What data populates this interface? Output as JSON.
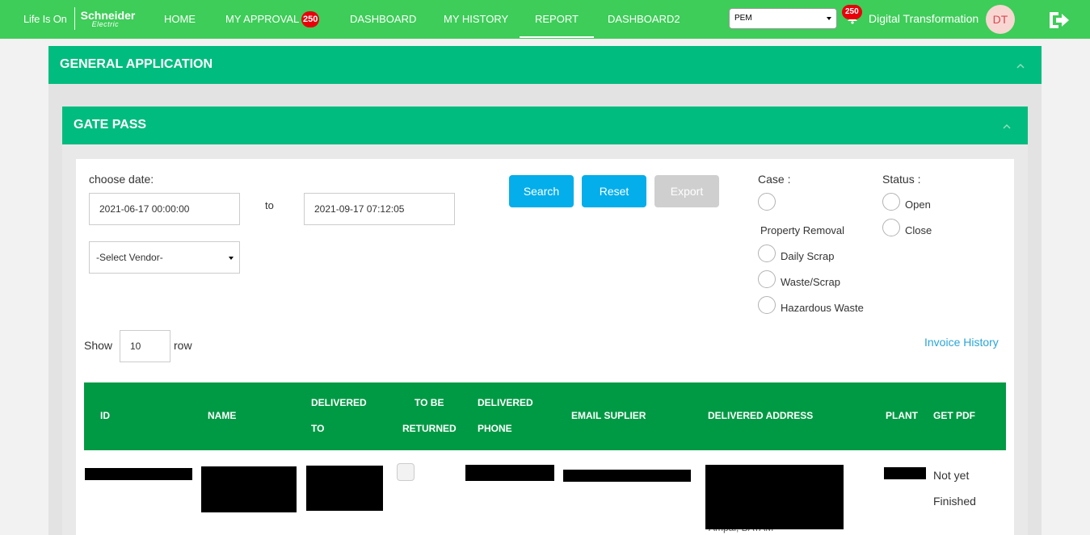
{
  "header": {
    "brand_lifeison": "Life Is On",
    "brand_name": "Schneider",
    "brand_sub": "Electric",
    "nav": [
      {
        "label": "HOME"
      },
      {
        "label": "MY APPROVAL",
        "badge": "250"
      },
      {
        "label": "DASHBOARD"
      },
      {
        "label": "MY HISTORY"
      },
      {
        "label": "REPORT",
        "active": true
      },
      {
        "label": "DASHBOARD2"
      }
    ],
    "plant_select": "PEM",
    "notification_count": "250",
    "user_name": "Digital Transformation",
    "avatar_initials": "DT"
  },
  "panels": {
    "general_title": "GENERAL APPLICATION",
    "gate_title": "GATE PASS"
  },
  "filters": {
    "choose_date_label": "choose date:",
    "date_from": "2021-06-17 00:00:00",
    "to_label": "to",
    "date_to": "2021-09-17 07:12:05",
    "vendor_select": "-Select Vendor-",
    "search_label": "Search",
    "reset_label": "Reset",
    "export_label": "Export",
    "case_label": "Case :",
    "case_options": [
      "Property Removal",
      "Daily Scrap",
      "Waste/Scrap",
      "Hazardous Waste"
    ],
    "status_label": "Status :",
    "status_options": [
      "Open",
      "Close"
    ],
    "show_label": "Show",
    "rows_value": "10",
    "row_label": "row",
    "invoice_history": "Invoice History"
  },
  "table": {
    "headers": {
      "id": "ID",
      "name": "NAME",
      "delivered_to_1": "DELIVERED",
      "delivered_to_2": "TO",
      "to_be_returned_1": "TO BE",
      "to_be_returned_2": "RETURNED",
      "delivered_phone_1": "DELIVERED",
      "delivered_phone_2": "PHONE",
      "email": "EMAIL SUPLIER",
      "address": "DELIVERED ADDRESS",
      "plant": "PLANT",
      "pdf": "GET PDF"
    },
    "rows": [
      {
        "pdf_status_1": "Not yet",
        "pdf_status_2": "Finished",
        "address_tail": "Ampal, BATAM"
      }
    ]
  },
  "colors": {
    "topbar": "#3dcd58",
    "panel_header": "#00bc7e",
    "table_header": "#009a44",
    "button_blue": "#03aeeb",
    "badge_red": "#e8000b"
  }
}
